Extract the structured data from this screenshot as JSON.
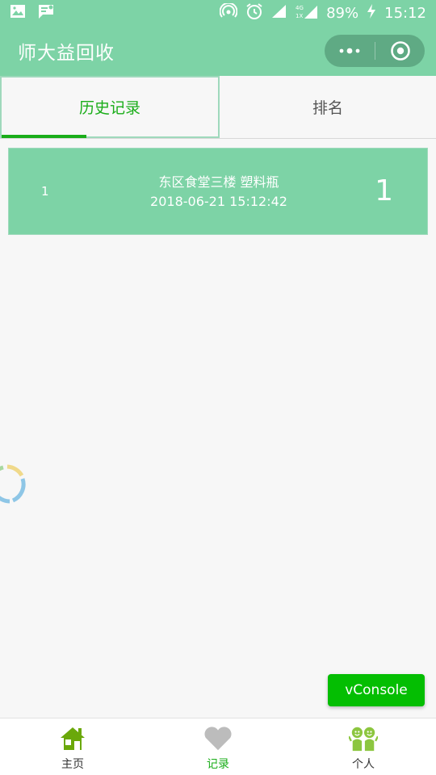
{
  "status_bar": {
    "battery": "89%",
    "time": "15:12"
  },
  "navbar": {
    "title": "师大益回收"
  },
  "tabs": [
    {
      "label": "历史记录",
      "active": true
    },
    {
      "label": "排名",
      "active": false
    }
  ],
  "records": [
    {
      "index": "1",
      "location": "东区食堂三楼 塑料瓶",
      "time": "2018-06-21 15:12:42",
      "count": "1"
    }
  ],
  "vconsole": {
    "label": "vConsole"
  },
  "tabbar": {
    "items": [
      {
        "label": "主页",
        "icon": "home-icon"
      },
      {
        "label": "记录",
        "icon": "heart-icon",
        "active": true
      },
      {
        "label": "个人",
        "icon": "people-icon"
      }
    ]
  },
  "colors": {
    "theme": "#7dd3a6",
    "accent": "#1aad19",
    "vconsole": "#04be02"
  }
}
